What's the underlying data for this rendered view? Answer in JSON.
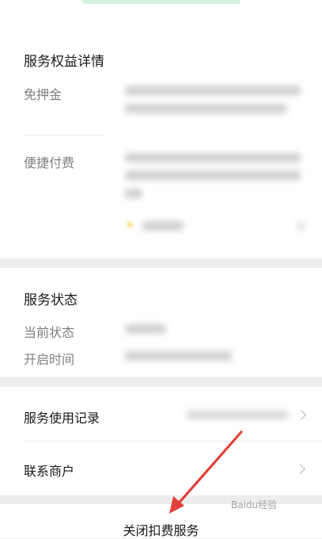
{
  "benefits": {
    "title": "服务权益详情",
    "items": [
      {
        "label": "免押金"
      },
      {
        "label": "便捷付费"
      }
    ]
  },
  "status": {
    "title": "服务状态",
    "rows": [
      {
        "label": "当前状态"
      },
      {
        "label": "开启时间"
      }
    ]
  },
  "links": {
    "usage_record": "服务使用记录",
    "contact_merchant": "联系商户"
  },
  "footer": {
    "close_service": "关闭扣费服务"
  },
  "watermark": "Baidu经验"
}
